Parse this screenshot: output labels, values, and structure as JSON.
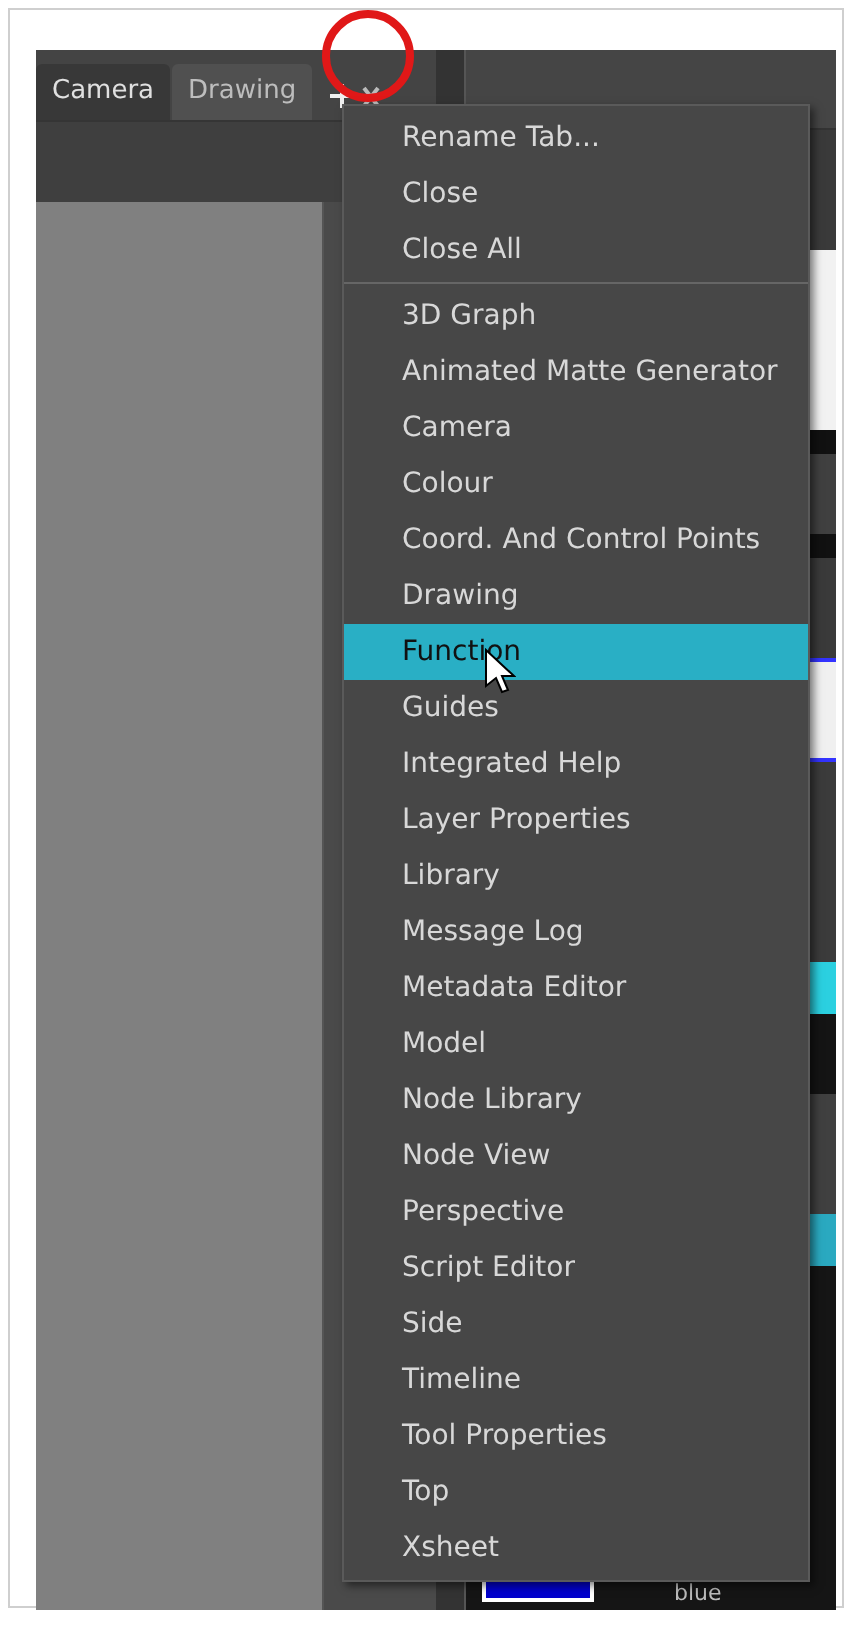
{
  "tabs": [
    {
      "label": "Camera",
      "selected": true
    },
    {
      "label": "Drawing",
      "selected": false
    }
  ],
  "menu": {
    "sections": [
      {
        "items": [
          {
            "label": "Rename Tab...",
            "selected": false
          },
          {
            "label": "Close",
            "selected": false
          },
          {
            "label": "Close All",
            "selected": false
          }
        ]
      },
      {
        "items": [
          {
            "label": "3D Graph",
            "selected": false
          },
          {
            "label": "Animated Matte Generator",
            "selected": false
          },
          {
            "label": "Camera",
            "selected": false
          },
          {
            "label": "Colour",
            "selected": false
          },
          {
            "label": "Coord. And Control Points",
            "selected": false
          },
          {
            "label": "Drawing",
            "selected": false
          },
          {
            "label": "Function",
            "selected": true
          },
          {
            "label": "Guides",
            "selected": false
          },
          {
            "label": "Integrated Help",
            "selected": false
          },
          {
            "label": "Layer Properties",
            "selected": false
          },
          {
            "label": "Library",
            "selected": false
          },
          {
            "label": "Message Log",
            "selected": false
          },
          {
            "label": "Metadata Editor",
            "selected": false
          },
          {
            "label": "Model",
            "selected": false
          },
          {
            "label": "Node Library",
            "selected": false
          },
          {
            "label": "Node View",
            "selected": false
          },
          {
            "label": "Perspective",
            "selected": false
          },
          {
            "label": "Script Editor",
            "selected": false
          },
          {
            "label": "Side",
            "selected": false
          },
          {
            "label": "Timeline",
            "selected": false
          },
          {
            "label": "Tool Properties",
            "selected": false
          },
          {
            "label": "Top",
            "selected": false
          },
          {
            "label": "Xsheet",
            "selected": false
          }
        ]
      }
    ]
  },
  "swatch_label": "blue"
}
